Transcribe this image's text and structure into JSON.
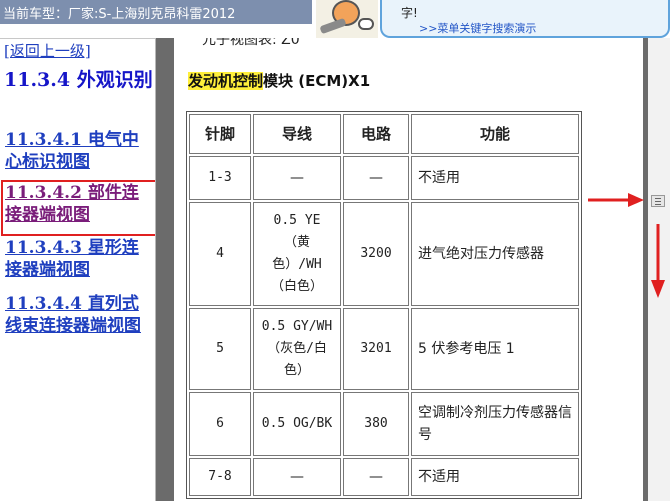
{
  "window": {
    "title": "当前车型：厂家:S-上海别克昂科雷2012"
  },
  "banner": {
    "visible_char": "字!",
    "link_text": ">>菜单关键字搜索演示"
  },
  "nav": {
    "back_link": "[返回上一级]",
    "section_heading": "11.3.4 外观识别",
    "items": [
      {
        "label": "11.3.4.1 电气中心标识视图",
        "visited": false
      },
      {
        "label": "11.3.4.2 部件连接器端视图",
        "visited": true,
        "highlighted": true
      },
      {
        "label": "11.3.4.3 星形连接器端视图",
        "visited": false
      },
      {
        "label": "11.3.4.4 直列式线束连接器端视图",
        "visited": false
      }
    ]
  },
  "document": {
    "partial_top_text": "元子视图表: Z0",
    "module_title_highlight": "发动机控制",
    "module_title_rest": "模块 (ECM)X1",
    "table": {
      "headers": [
        "针脚",
        "导线",
        "电路",
        "功能"
      ],
      "rows": [
        {
          "pin": "1-3",
          "wire": "—",
          "circuit": "—",
          "function": "不适用"
        },
        {
          "pin": "4",
          "wire": "0.5 YE\n（黄\n色）/WH\n（白色）",
          "circuit": "3200",
          "function": "进气绝对压力传感器"
        },
        {
          "pin": "5",
          "wire": "0.5 GY/WH\n（灰色/白\n色）",
          "circuit": "3201",
          "function": "5 伏参考电压 1"
        },
        {
          "pin": "6",
          "wire": "0.5 OG/BK",
          "circuit": "380",
          "function": "空调制冷剂压力传感器信号"
        },
        {
          "pin": "7-8",
          "wire": "—",
          "circuit": "—",
          "function": "不适用"
        }
      ]
    }
  },
  "colors": {
    "title_strip": "#7d8fae",
    "nav_link": "#1f3fbf",
    "nav_visited": "#7a1d7a",
    "heading": "#1515c8",
    "highlight": "#ffef3b",
    "annotation_red": "#e02020",
    "frame_gray": "#6b6b6b"
  },
  "icons": {
    "mascot": "mechanic-mascot-icon",
    "scroll_thumb": "scroll-thumb-icon",
    "arrow_left": "red-arrow-left-icon",
    "arrow_down": "red-arrow-down-icon"
  }
}
